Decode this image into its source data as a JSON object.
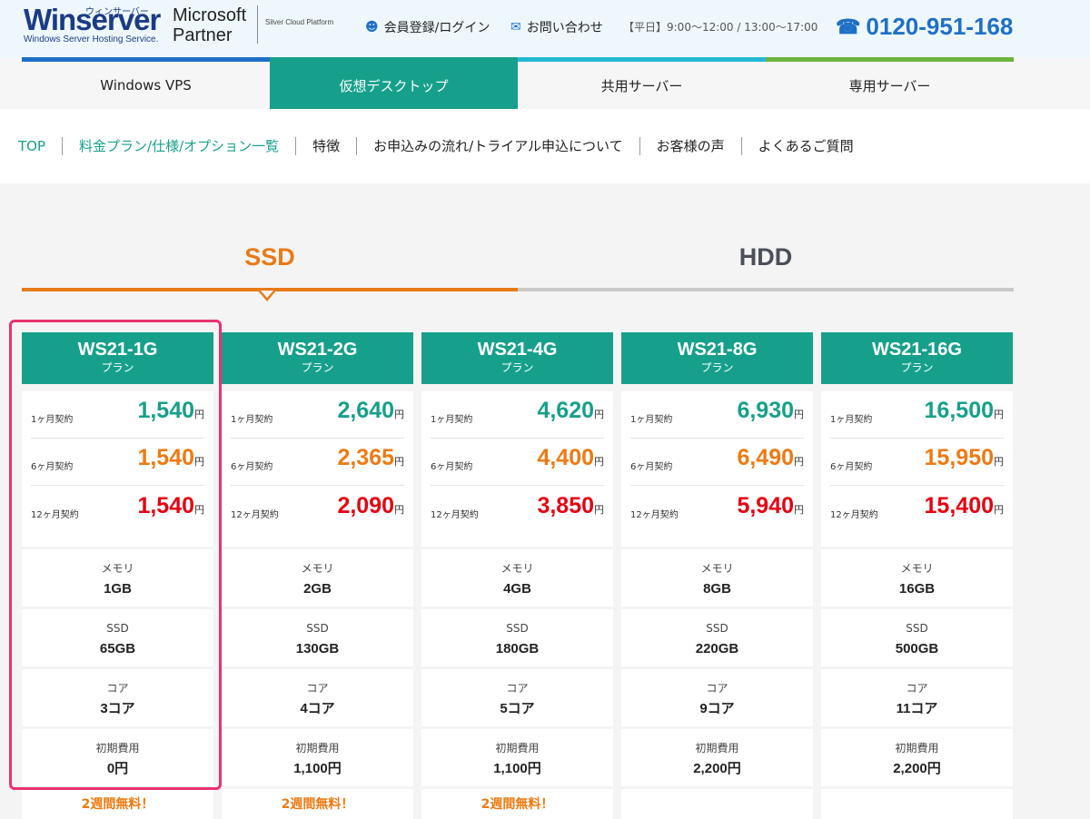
{
  "header": {
    "logo_main": "Winserver",
    "logo_kana": "ウィンサーバー",
    "logo_sub": "Windows Server Hosting Service.",
    "ms_line1": "Microsoft",
    "ms_line2": "Partner",
    "ms_silver": "Silver Cloud Platform",
    "register_label": "会員登録/ログイン",
    "contact_label": "お問い合わせ",
    "hours": "【平日】9:00～12:00 / 13:00～17:00",
    "phone": "0120-951-168"
  },
  "tabs": [
    {
      "label": "Windows VPS",
      "color": "#1e6fc7"
    },
    {
      "label": "仮想デスクトップ",
      "color": "#16a08b"
    },
    {
      "label": "共用サーバー",
      "color": "#25b8d4"
    },
    {
      "label": "専用サーバー",
      "color": "#6cb33f"
    }
  ],
  "subnav": [
    "TOP",
    "料金プラン/仕様/オプション一覧",
    "特徴",
    "お申込みの流れ/トライアル申込について",
    "お客様の声",
    "よくあるご質問"
  ],
  "storage_tabs": {
    "ssd": "SSD",
    "hdd": "HDD"
  },
  "labels": {
    "plan_suffix": "プラン",
    "m1": "1ヶ月契約",
    "m6": "6ヶ月契約",
    "m12": "12ヶ月契約",
    "yen": "円",
    "memory": "メモリ",
    "ssd": "SSD",
    "core": "コア",
    "initial": "初期費用",
    "trial": "2週間無料！"
  },
  "plans": [
    {
      "name": "WS21-1G",
      "p1": "1,540",
      "p6": "1,540",
      "p12": "1,540",
      "memory": "1GB",
      "ssd": "65GB",
      "core": "3コア",
      "initial": "0円",
      "trial": true
    },
    {
      "name": "WS21-2G",
      "p1": "2,640",
      "p6": "2,365",
      "p12": "2,090",
      "memory": "2GB",
      "ssd": "130GB",
      "core": "4コア",
      "initial": "1,100円",
      "trial": true
    },
    {
      "name": "WS21-4G",
      "p1": "4,620",
      "p6": "4,400",
      "p12": "3,850",
      "memory": "4GB",
      "ssd": "180GB",
      "core": "5コア",
      "initial": "1,100円",
      "trial": true
    },
    {
      "name": "WS21-8G",
      "p1": "6,930",
      "p6": "6,490",
      "p12": "5,940",
      "memory": "8GB",
      "ssd": "220GB",
      "core": "9コア",
      "initial": "2,200円",
      "trial": false
    },
    {
      "name": "WS21-16G",
      "p1": "16,500",
      "p6": "15,950",
      "p12": "15,400",
      "memory": "16GB",
      "ssd": "500GB",
      "core": "11コア",
      "initial": "2,200円",
      "trial": false
    }
  ]
}
